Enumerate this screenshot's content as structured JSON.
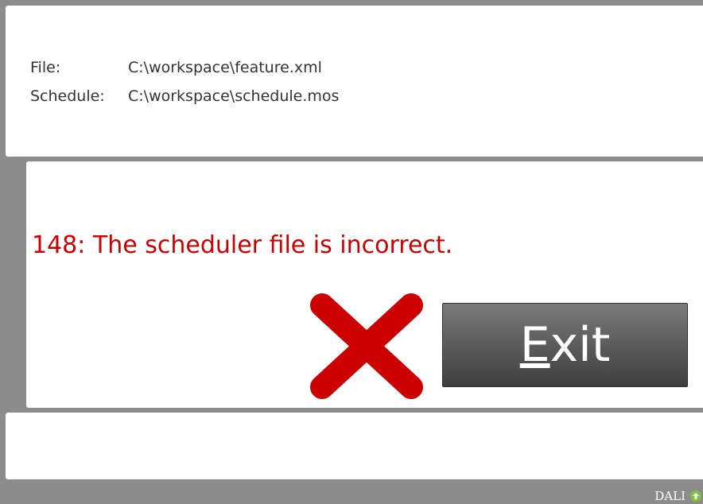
{
  "info": {
    "file_label": "File:",
    "file_value": "C:\\workspace\\feature.xml",
    "schedule_label": "Schedule:",
    "schedule_value": "C:\\workspace\\schedule.mos"
  },
  "error": {
    "message": "148: The scheduler file is incorrect.",
    "icon": "error-x-icon",
    "color": "#cc0000"
  },
  "exit_button": {
    "mnemonic": "E",
    "rest": "xit"
  },
  "status": {
    "label": "DALI",
    "icon": "status-indicator-icon",
    "icon_color": "#7cc242"
  }
}
